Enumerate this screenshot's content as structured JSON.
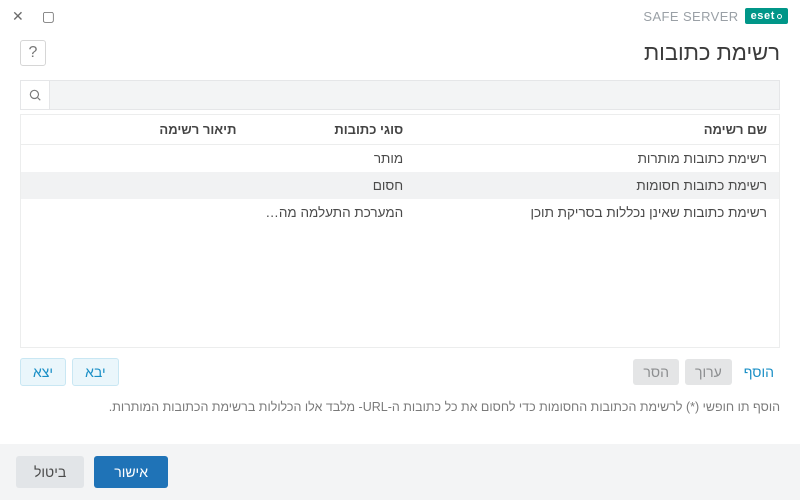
{
  "brand": {
    "badge": "eset",
    "product": "SAFE SERVER"
  },
  "header": {
    "title": "רשימת כתובות"
  },
  "search": {
    "value": ""
  },
  "table": {
    "columns": {
      "name": "שם רשימה",
      "type": "סוגי כתובות",
      "desc": "תיאור רשימה"
    },
    "rows": [
      {
        "name": "רשימת כתובות מותרות",
        "type": "מותר",
        "desc": ""
      },
      {
        "name": "רשימת כתובות חסומות",
        "type": "חסום",
        "desc": ""
      },
      {
        "name": "רשימת כתובות שאינן נכללות בסריקת תוכן",
        "type": "המערכת התעלמה מהתוכ...",
        "desc": ""
      }
    ],
    "selected_index": 1
  },
  "actions": {
    "add": "הוסף",
    "edit": "ערוך",
    "remove": "הסר",
    "import": "יבא",
    "export": "יצא"
  },
  "hint": "הוסף תו חופשי (*) לרשימת הכתובות החסומות כדי לחסום את כל כתובות ה-URL- מלבד אלו הכלולות ברשימת הכתובות המותרות.",
  "footer": {
    "ok": "אישור",
    "cancel": "ביטול"
  }
}
